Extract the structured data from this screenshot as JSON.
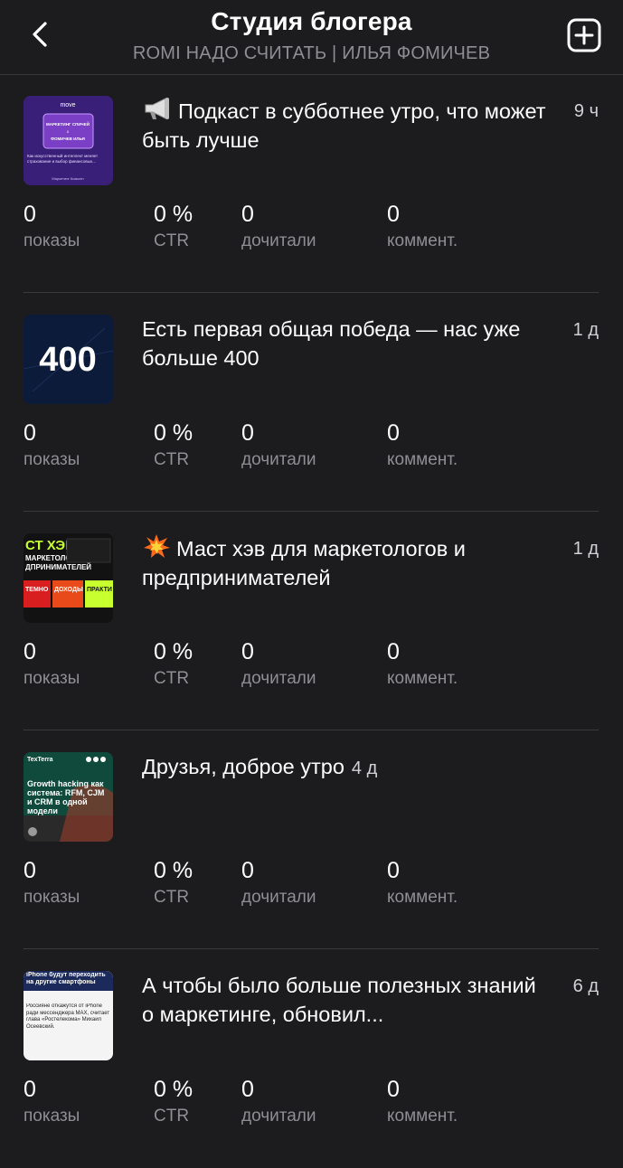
{
  "header": {
    "title": "Студия блогера",
    "subtitle": "ROMI НАДО СЧИТАТЬ | ИЛЬЯ ФОМИЧЕВ"
  },
  "stat_labels": {
    "views": "показы",
    "ctr": "CTR",
    "read": "дочитали",
    "comments": "коммент."
  },
  "posts": [
    {
      "icon": "megaphone-icon",
      "title": "Подкаст в субботнее утро, что может быть лучше",
      "time": "9 ч",
      "views": "0",
      "ctr": "0 %",
      "read": "0",
      "comments": "0",
      "thumb": {
        "brand": "move",
        "line1": "МАРКЕТИНГ СПИЧЕЙ",
        "line2": "x",
        "line3": "ФОМИЧЕВ ИЛЬЯ",
        "caption": "Как искусственный интеллект меняет страхование и выбор финансовых...",
        "footer": "Маркетинг Комьюн"
      }
    },
    {
      "icon": "",
      "title": "Есть первая общая победа — нас уже больше 400",
      "time": "1 д",
      "views": "0",
      "ctr": "0 %",
      "read": "0",
      "comments": "0",
      "thumb": {
        "big_text": "400"
      }
    },
    {
      "icon": "collision-icon",
      "title": "Маст хэв для маркетологов и предпринимателей",
      "time": "1 д",
      "views": "0",
      "ctr": "0 %",
      "read": "0",
      "comments": "0",
      "thumb": {
        "line1": "СТ ХЭВ",
        "line2": "МАРКЕТОЛОГОВ",
        "line3": "ДПРИНИМАТЕЛЕЙ",
        "tag1": "ТЕМНО",
        "tag2": "ДОХОДЫ",
        "tag3": "ПРАКТИ"
      }
    },
    {
      "icon": "",
      "title": "Друзья, доброе утро",
      "time": "4 д",
      "views": "0",
      "ctr": "0 %",
      "read": "0",
      "comments": "0",
      "thumb": {
        "brand": "TexTerra",
        "headline": "Growth hacking как система: RFM, CJM и CRM в одной модели"
      }
    },
    {
      "icon": "",
      "title": "А чтобы было больше полезных знаний о маркетинге, обновил...",
      "time": "6 д",
      "views": "0",
      "ctr": "0 %",
      "read": "0",
      "comments": "0",
      "thumb": {
        "headline": "iPhone будут переходить на другие смартфоны",
        "body": "Россияне откажутся от iPhone ради мессенджера MAX, считает глава «Ростелекома» Михаил Осеевский."
      }
    }
  ],
  "colors": {
    "background": "#1c1c1e",
    "text": "#ffffff",
    "muted": "#8e8e93",
    "divider": "#3a3a3c"
  }
}
